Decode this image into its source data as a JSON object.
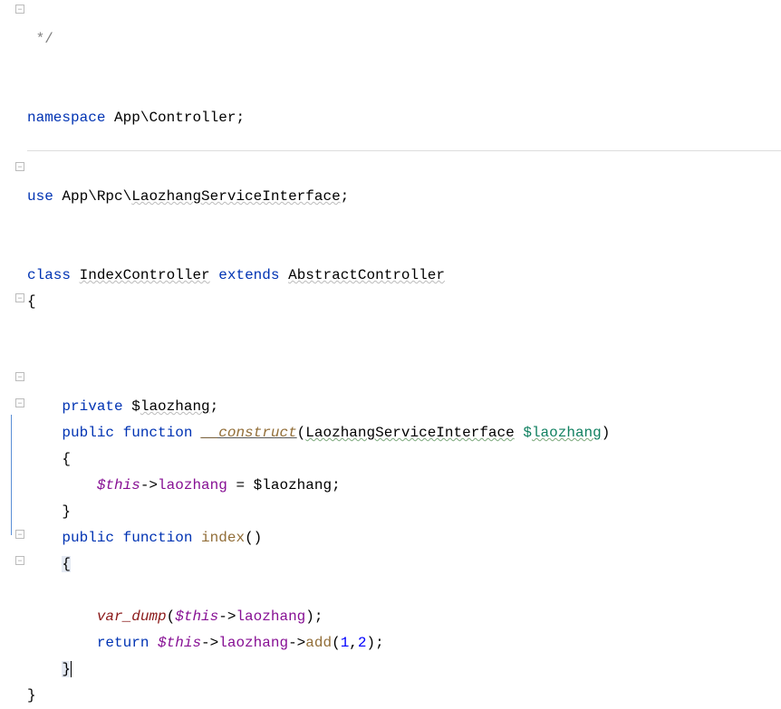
{
  "code": {
    "comment_end": " */",
    "ns": {
      "kw": "namespace",
      "name": "App\\Controller",
      "semi": ";"
    },
    "use": {
      "kw": "use",
      "path1": "App\\Rpc\\",
      "iface": "LaozhangServiceInterface",
      "semi": ";"
    },
    "klass": {
      "kw": "class",
      "name": "IndexController",
      "extends": "extends",
      "parent": "AbstractController",
      "open": "{",
      "close": "}"
    },
    "prop": {
      "vis": "private",
      "sigil": "$",
      "name": "laozhang",
      "semi": ";"
    },
    "ctor": {
      "vis": "public",
      "fn_kw": "function",
      "name": "__construct",
      "open_paren": "(",
      "ptype": "LaozhangServiceInterface",
      "sigil": "$",
      "pname": "laozhang",
      "close_paren": ")",
      "open": "{",
      "sigil_this": "$",
      "this": "this",
      "arrow": "->",
      "prop": "laozhang",
      "eq": " = ",
      "sigil2": "$",
      "rhs": "laozhang",
      "semi": ";",
      "close": "}"
    },
    "idx": {
      "vis": "public",
      "fn_kw": "function",
      "name": "index",
      "parens": "()",
      "open": "{",
      "vd": "var_dump",
      "open_p": "(",
      "sigil_this": "$",
      "this": "this",
      "arrow": "->",
      "prop": "laozhang",
      "close_p": ")",
      "semi": ";",
      "ret_kw": "return",
      "sigil_this2": "$",
      "this2": "this",
      "arrow2": "->",
      "prop2": "laozhang",
      "arrow3": "->",
      "method": "add",
      "arg_open": "(",
      "arg1": "1",
      "comma": ",",
      "arg2": "2",
      "arg_close": ")",
      "semi2": ";",
      "close": "}"
    }
  },
  "icons": {
    "minus": "−",
    "plus": "+"
  }
}
